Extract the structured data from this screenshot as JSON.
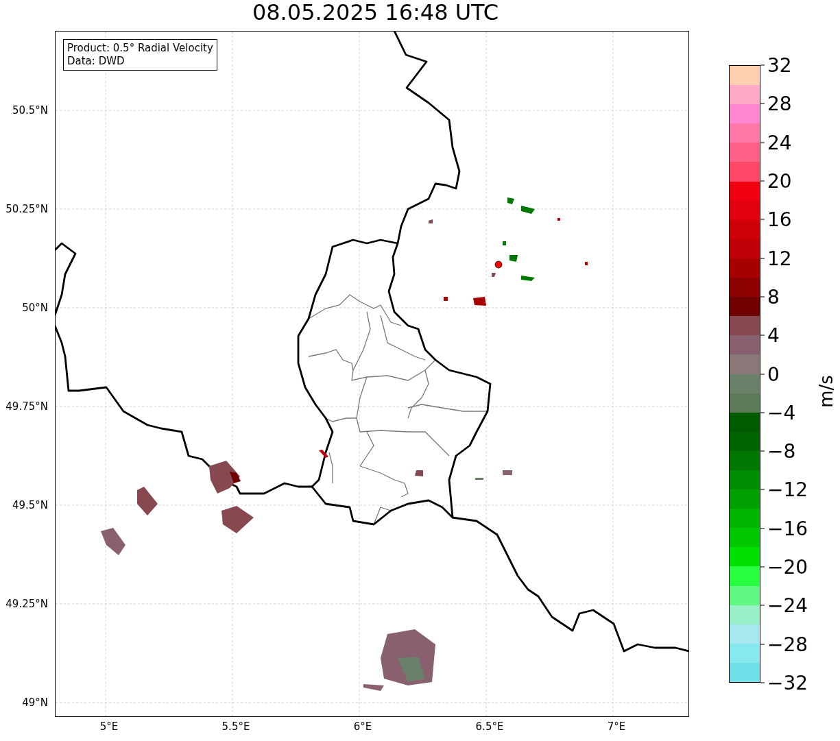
{
  "title": "08.05.2025 16:48 UTC",
  "legend": {
    "lines": [
      "Product: 0.5° Radial Velocity",
      "Data: DWD"
    ]
  },
  "lat_ticks": [
    "50.5°N",
    "50.25°N",
    "50°N",
    "49.75°N",
    "49.5°N",
    "49.25°N",
    "49°N"
  ],
  "lon_ticks": [
    "5°E",
    "5.5°E",
    "6°E",
    "6.5°E",
    "7°E"
  ],
  "colorbar": {
    "label": "m/s",
    "ticks": [
      "32",
      "28",
      "24",
      "20",
      "16",
      "12",
      "8",
      "4",
      "0",
      "−4",
      "−8",
      "−12",
      "−16",
      "−20",
      "−24",
      "−28",
      "−32"
    ],
    "segments": [
      {
        "color": "#ffcfb0"
      },
      {
        "color": "#ffa8c8"
      },
      {
        "color": "#ff88d0"
      },
      {
        "color": "#ff78a8"
      },
      {
        "color": "#ff6088"
      },
      {
        "color": "#ff4868"
      },
      {
        "color": "#f00010"
      },
      {
        "color": "#e00010"
      },
      {
        "color": "#d00008"
      },
      {
        "color": "#c00008"
      },
      {
        "color": "#a80000"
      },
      {
        "color": "#8c0000"
      },
      {
        "color": "#700000"
      },
      {
        "color": "#884850"
      },
      {
        "color": "#886070"
      },
      {
        "color": "#8a7878"
      },
      {
        "color": "#6a8068"
      },
      {
        "color": "#5a7a58"
      },
      {
        "color": "#005a00"
      },
      {
        "color": "#006400"
      },
      {
        "color": "#007800"
      },
      {
        "color": "#008c00"
      },
      {
        "color": "#00a000"
      },
      {
        "color": "#00b400"
      },
      {
        "color": "#00c800"
      },
      {
        "color": "#00e000"
      },
      {
        "color": "#28ff40"
      },
      {
        "color": "#60f880"
      },
      {
        "color": "#98f0c8"
      },
      {
        "color": "#a8e8f0"
      },
      {
        "color": "#88e8f0"
      },
      {
        "color": "#70e0e8"
      }
    ]
  }
}
